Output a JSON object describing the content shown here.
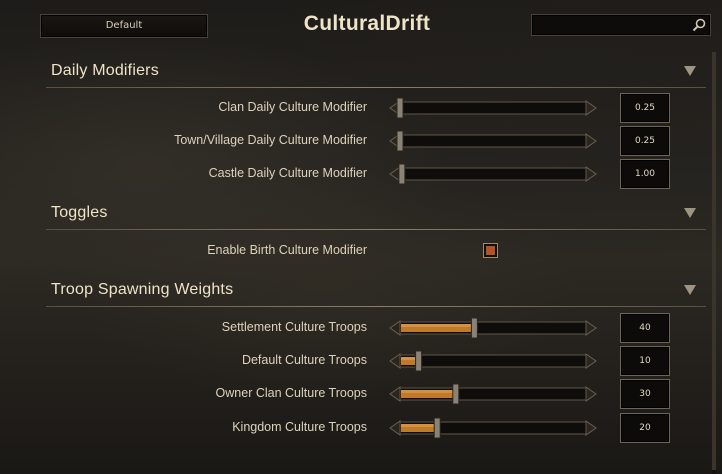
{
  "header": {
    "preset_label": "Default",
    "title": "CulturalDrift",
    "search_value": ""
  },
  "sections": [
    {
      "title": "Daily Modifiers",
      "rows": [
        {
          "label": "Clan Daily Culture Modifier",
          "value": "0.25",
          "fill_fraction": 0.0
        },
        {
          "label": "Town/Village Daily Culture Modifier",
          "value": "0.25",
          "fill_fraction": 0.0
        },
        {
          "label": "Castle Daily Culture Modifier",
          "value": "1.00",
          "fill_fraction": 0.01
        }
      ]
    },
    {
      "title": "Toggles",
      "rows": [
        {
          "label": "Enable Birth Culture Modifier",
          "checked": true
        }
      ]
    },
    {
      "title": "Troop Spawning Weights",
      "rows": [
        {
          "label": "Settlement Culture Troops",
          "value": "40",
          "fill_fraction": 0.4
        },
        {
          "label": "Default Culture Troops",
          "value": "10",
          "fill_fraction": 0.1
        },
        {
          "label": "Owner Clan Culture Troops",
          "value": "30",
          "fill_fraction": 0.3
        },
        {
          "label": "Kingdom Culture Troops",
          "value": "20",
          "fill_fraction": 0.2
        }
      ]
    }
  ],
  "icons": {
    "search": "search-icon",
    "collapse": "chevron-down-icon"
  },
  "colors": {
    "slider_fill": "#c07a2c",
    "checkbox_mark": "#b0522a",
    "text": "#ddd2bb"
  }
}
